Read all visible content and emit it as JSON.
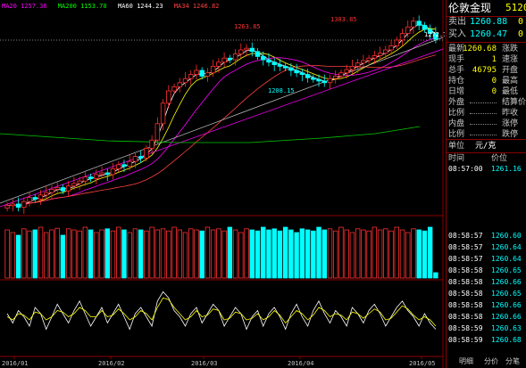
{
  "legend": [
    {
      "label": "MA20",
      "value": "1257.36",
      "color": "#ff00ff"
    },
    {
      "label": "MA200",
      "value": "1153.70",
      "color": "#00ff00"
    },
    {
      "label": "MA60",
      "value": "1244.23",
      "color": "#ffffff"
    },
    {
      "label": "MA34",
      "value": "1246.82",
      "color": "#ff4040"
    }
  ],
  "annotations": {
    "high1": "1263.85",
    "high2": "1303.85",
    "low1": "1208.15",
    "last": "1272.74"
  },
  "x_ticks": [
    "2016/01",
    "2016/02",
    "2016/03",
    "2016/04",
    "2016/05"
  ],
  "panel": {
    "title": "伦敦金现",
    "code": "5120",
    "sell_label": "卖出",
    "sell_value": "1260.88",
    "sell_qty": "0",
    "buy_label": "买入",
    "buy_value": "1260.47",
    "buy_qty": "0",
    "quote_rows": [
      {
        "l1": "最新",
        "v1": "1260.68",
        "l2": "涨跌",
        "c1": "yel"
      },
      {
        "l1": "现手",
        "v1": "1",
        "l2": "速涨",
        "c1": "yel"
      },
      {
        "l1": "总手",
        "v1": "46795",
        "l2": "开盘",
        "c1": "yel"
      },
      {
        "l1": "持仓",
        "v1": "0",
        "l2": "最高",
        "c1": "yel"
      },
      {
        "l1": "日增",
        "v1": "0",
        "l2": "最低",
        "c1": "yel"
      },
      {
        "l1": "外盘",
        "v1": "",
        "l2": "结算价",
        "c1": "yel"
      },
      {
        "l1": "比例",
        "v1": "",
        "l2": "昨收",
        "c1": "yel"
      },
      {
        "l1": "内盘",
        "v1": "",
        "l2": "涨停",
        "c1": "yel"
      },
      {
        "l1": "比例",
        "v1": "",
        "l2": "跌停",
        "c1": "yel"
      }
    ],
    "unit_label": "单位",
    "unit_value": "元/克",
    "tick_header": {
      "time": "时间",
      "price": "价位"
    },
    "ticks": [
      {
        "t": "08:57:00",
        "p": "1261.16"
      },
      {
        "t": "08:58:57",
        "p": "1260.60"
      },
      {
        "t": "08:58:57",
        "p": "1260.64"
      },
      {
        "t": "08:58:57",
        "p": "1260.64"
      },
      {
        "t": "08:58:58",
        "p": "1260.65"
      },
      {
        "t": "08:58:58",
        "p": "1260.66"
      },
      {
        "t": "08:58:58",
        "p": "1260.65"
      },
      {
        "t": "08:58:58",
        "p": "1260.66"
      },
      {
        "t": "08:58:58",
        "p": "1260.66"
      },
      {
        "t": "08:58:59",
        "p": "1260.63"
      },
      {
        "t": "08:58:59",
        "p": "1260.68"
      }
    ],
    "bottom_tabs": [
      "明细",
      "分价",
      "分笔"
    ]
  },
  "chart_data": {
    "type": "candlestick",
    "ylim": [
      1060,
      1310
    ],
    "close": [
      1070,
      1072,
      1068,
      1075,
      1080,
      1078,
      1083,
      1086,
      1090,
      1092,
      1088,
      1094,
      1097,
      1100,
      1105,
      1103,
      1108,
      1110,
      1108,
      1115,
      1120,
      1118,
      1124,
      1130,
      1128,
      1140,
      1150,
      1170,
      1195,
      1210,
      1215,
      1220,
      1225,
      1230,
      1235,
      1228,
      1232,
      1240,
      1245,
      1250,
      1248,
      1255,
      1260,
      1262,
      1258,
      1252,
      1248,
      1245,
      1242,
      1240,
      1238,
      1235,
      1232,
      1230,
      1226,
      1224,
      1222,
      1220,
      1225,
      1228,
      1232,
      1236,
      1240,
      1244,
      1247,
      1250,
      1253,
      1256,
      1260,
      1265,
      1272,
      1280,
      1288,
      1295,
      1290,
      1285,
      1280,
      1273
    ],
    "volume_ratio": [
      0.9,
      0.85,
      0.8,
      0.92,
      0.88,
      0.9,
      0.95,
      0.85,
      0.9,
      0.93,
      0.8,
      0.92,
      0.9,
      0.88,
      0.95,
      0.9,
      0.85,
      0.9,
      0.92,
      0.88,
      0.95,
      0.9,
      0.85,
      0.92,
      0.9,
      0.88,
      0.95,
      0.9,
      0.92,
      0.88,
      0.95,
      0.9,
      0.85,
      0.92,
      0.9,
      0.88,
      0.95,
      0.9,
      0.92,
      0.88,
      0.95,
      0.9,
      0.85,
      0.92,
      0.9,
      0.88,
      0.95,
      0.9,
      0.92,
      0.88,
      0.95,
      0.9,
      0.85,
      0.92,
      0.9,
      0.88,
      0.95,
      0.9,
      0.92,
      0.88,
      0.95,
      0.9,
      0.85,
      0.92,
      0.9,
      0.88,
      0.95,
      0.9,
      0.92,
      0.88,
      0.95,
      0.9,
      0.85,
      0.92,
      0.9,
      0.88,
      0.95,
      0.1
    ],
    "osc_a": [
      0.2,
      -0.1,
      0.3,
      0.1,
      -0.2,
      0.4,
      0.2,
      -0.3,
      0.1,
      0.5,
      0.2,
      -0.1,
      0.3,
      0.6,
      0.2,
      -0.2,
      0.1,
      0.4,
      -0.1,
      0.2,
      0.5,
      0.1,
      -0.3,
      0.2,
      0.4,
      0.1,
      -0.2,
      0.6,
      0.9,
      0.7,
      0.3,
      0.1,
      -0.2,
      0.2,
      0.4,
      -0.1,
      0.2,
      0.5,
      0.3,
      -0.2,
      0.1,
      0.4,
      0.2,
      -0.3,
      0.1,
      0.3,
      -0.2,
      0.2,
      0.4,
      0.1,
      -0.3,
      0.2,
      0.5,
      0.1,
      -0.2,
      0.3,
      0.6,
      0.2,
      -0.1,
      0.3,
      0.1,
      -0.2,
      0.4,
      0.2,
      -0.1,
      0.3,
      0.5,
      0.2,
      -0.2,
      0.1,
      0.4,
      0.6,
      0.3,
      0.1,
      -0.2,
      0.2,
      -0.1,
      -0.3
    ],
    "osc_b": [
      0.1,
      0.0,
      0.2,
      0.15,
      0.0,
      0.25,
      0.2,
      0.0,
      0.1,
      0.3,
      0.25,
      0.1,
      0.2,
      0.4,
      0.3,
      0.1,
      0.1,
      0.3,
      0.1,
      0.15,
      0.35,
      0.2,
      0.0,
      0.1,
      0.3,
      0.2,
      0.0,
      0.4,
      0.7,
      0.65,
      0.4,
      0.2,
      0.0,
      0.1,
      0.3,
      0.1,
      0.15,
      0.35,
      0.3,
      0.0,
      0.05,
      0.25,
      0.2,
      0.0,
      0.05,
      0.2,
      0.0,
      0.1,
      0.3,
      0.15,
      -0.1,
      0.1,
      0.3,
      0.2,
      0.0,
      0.15,
      0.4,
      0.3,
      0.1,
      0.2,
      0.15,
      0.0,
      0.25,
      0.2,
      0.05,
      0.2,
      0.35,
      0.25,
      0.0,
      0.05,
      0.25,
      0.45,
      0.35,
      0.15,
      0.0,
      0.1,
      0.0,
      -0.2
    ]
  }
}
